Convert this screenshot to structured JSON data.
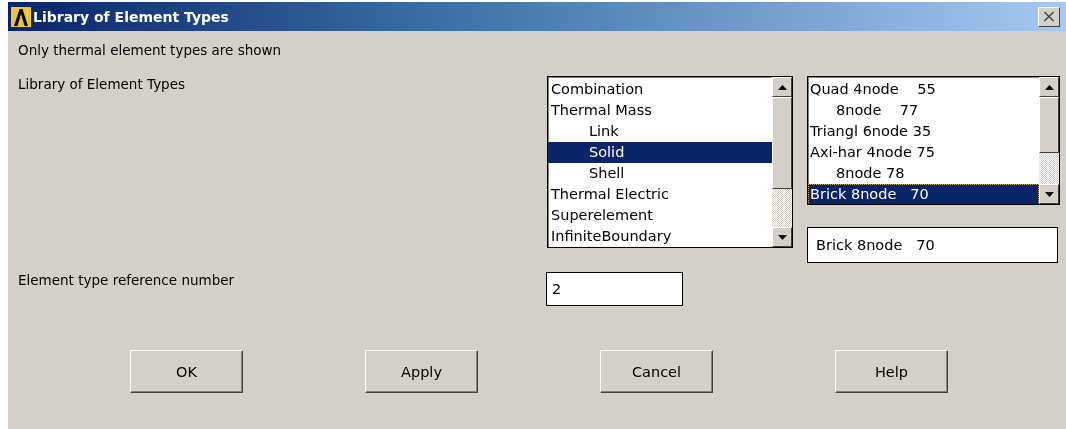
{
  "window": {
    "title": "Library of Element Types"
  },
  "note": "Only thermal element types are shown",
  "library_label": "Library of Element Types",
  "category_list": [
    {
      "label": "Combination",
      "selected": false
    },
    {
      "label": "Thermal Mass",
      "selected": false,
      "children": [
        {
          "label": "Link",
          "selected": false
        },
        {
          "label": "Solid",
          "selected": true
        },
        {
          "label": "Shell",
          "selected": false
        }
      ]
    },
    {
      "label": "Thermal Electric",
      "selected": false
    },
    {
      "label": "Superelement",
      "selected": false
    },
    {
      "label": "InfiniteBoundary",
      "selected": false
    }
  ],
  "type_list": [
    {
      "label": "Quad 4node    55",
      "selected": false,
      "children": [
        {
          "label": "8node    77",
          "selected": false
        }
      ]
    },
    {
      "label": "Triangl 6node 35",
      "selected": false
    },
    {
      "label": "Axi-har 4node 75",
      "selected": false,
      "children": [
        {
          "label": "8node 78",
          "selected": false
        }
      ]
    },
    {
      "label": "Brick 8node   70",
      "selected": true
    }
  ],
  "selection_field": {
    "value": "Brick 8node   70"
  },
  "reference_label": "Element type reference number",
  "reference_field": {
    "value": "2"
  },
  "buttons": [
    "OK",
    "Apply",
    "Cancel",
    "Help"
  ]
}
